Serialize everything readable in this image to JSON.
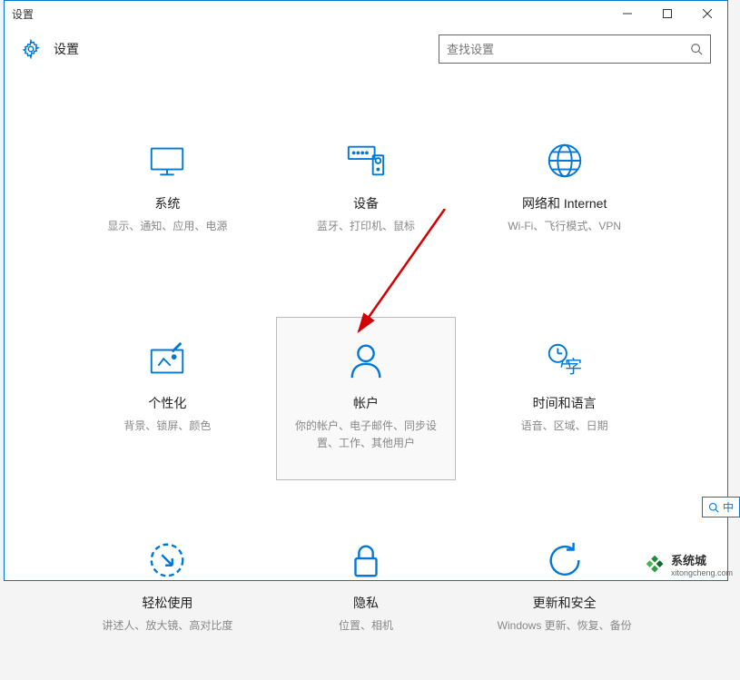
{
  "titlebar": {
    "title": "设置"
  },
  "header": {
    "title": "设置"
  },
  "search": {
    "placeholder": "查找设置"
  },
  "tiles": [
    {
      "title": "系统",
      "desc": "显示、通知、应用、电源",
      "highlighted": false
    },
    {
      "title": "设备",
      "desc": "蓝牙、打印机、鼠标",
      "highlighted": false
    },
    {
      "title": "网络和 Internet",
      "desc": "Wi-Fi、飞行模式、VPN",
      "highlighted": false
    },
    {
      "title": "个性化",
      "desc": "背景、锁屏、颜色",
      "highlighted": false
    },
    {
      "title": "帐户",
      "desc": "你的帐户、电子邮件、同步设置、工作、其他用户",
      "highlighted": true
    },
    {
      "title": "时间和语言",
      "desc": "语音、区域、日期",
      "highlighted": false
    },
    {
      "title": "轻松使用",
      "desc": "讲述人、放大镜、高对比度",
      "highlighted": false
    },
    {
      "title": "隐私",
      "desc": "位置、相机",
      "highlighted": false
    },
    {
      "title": "更新和安全",
      "desc": "Windows 更新、恢复、备份",
      "highlighted": false
    }
  ],
  "mini_search": {
    "label": "中"
  },
  "watermark": {
    "name": "系统城",
    "url": "xitongcheng.com"
  }
}
